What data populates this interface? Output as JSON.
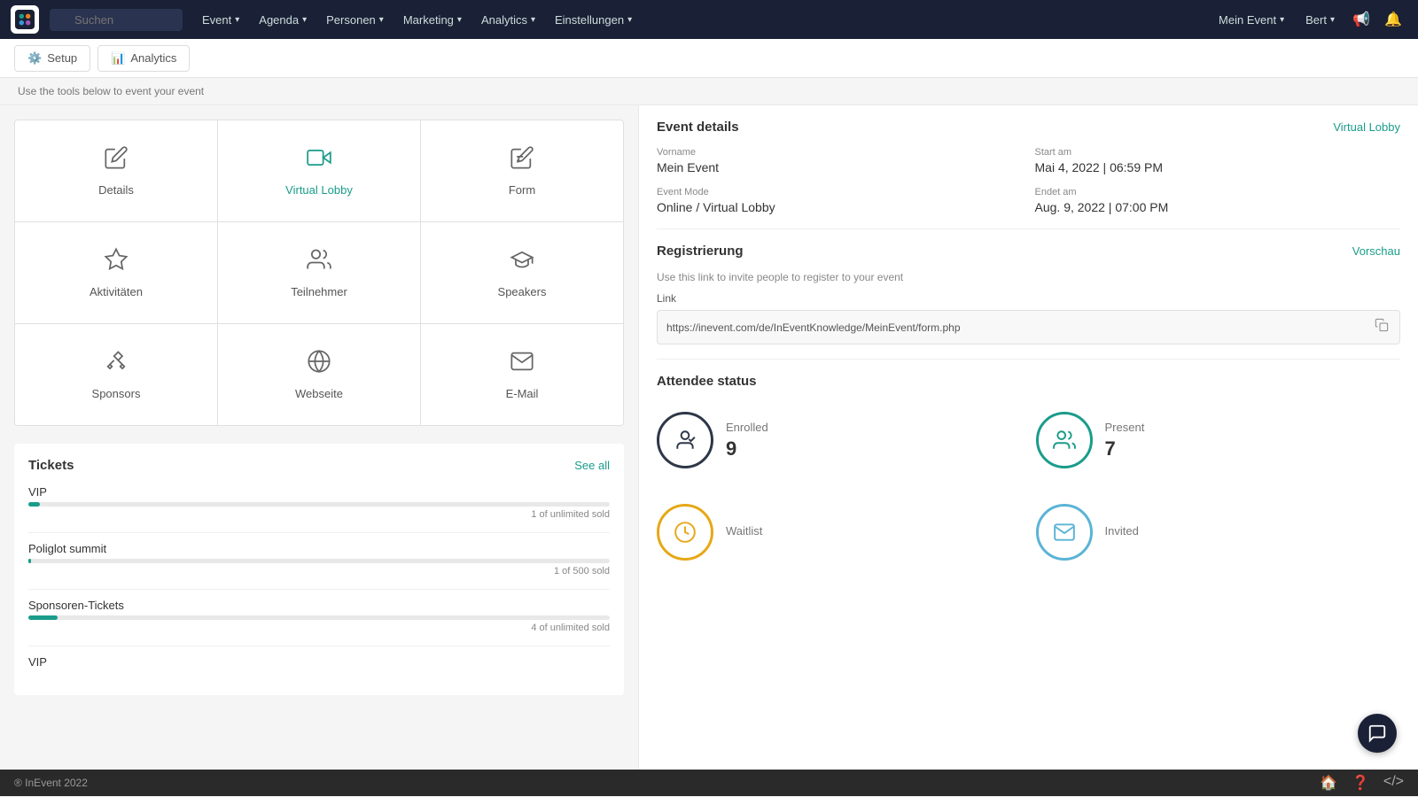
{
  "nav": {
    "search_placeholder": "Suchen",
    "menu_items": [
      {
        "label": "Event",
        "id": "event"
      },
      {
        "label": "Agenda",
        "id": "agenda"
      },
      {
        "label": "Personen",
        "id": "personen"
      },
      {
        "label": "Marketing",
        "id": "marketing"
      },
      {
        "label": "Analytics",
        "id": "analytics"
      },
      {
        "label": "Einstellungen",
        "id": "einstellungen"
      }
    ],
    "right_items": [
      {
        "label": "Mein Event",
        "id": "mein-event"
      },
      {
        "label": "Bert",
        "id": "bert"
      }
    ]
  },
  "sub_nav": {
    "setup_label": "Setup",
    "analytics_label": "Analytics"
  },
  "helper_text": "Use the tools below to event your event",
  "tools": [
    {
      "id": "details",
      "label": "Details",
      "icon": "✏️",
      "highlight": false
    },
    {
      "id": "virtual-lobby",
      "label": "Virtual Lobby",
      "icon": "🎥",
      "highlight": true
    },
    {
      "id": "form",
      "label": "Form",
      "icon": "📝",
      "highlight": false
    },
    {
      "id": "aktivitaten",
      "label": "Aktivitäten",
      "icon": "⭐",
      "highlight": false
    },
    {
      "id": "teilnehmer",
      "label": "Teilnehmer",
      "icon": "👥",
      "highlight": false
    },
    {
      "id": "speakers",
      "label": "Speakers",
      "icon": "🎓",
      "highlight": false
    },
    {
      "id": "sponsors",
      "label": "Sponsors",
      "icon": "🤝",
      "highlight": false
    },
    {
      "id": "webseite",
      "label": "Webseite",
      "icon": "🌐",
      "highlight": false
    },
    {
      "id": "email",
      "label": "E-Mail",
      "icon": "✉️",
      "highlight": false
    }
  ],
  "tickets": {
    "title": "Tickets",
    "see_all": "See all",
    "items": [
      {
        "name": "VIP",
        "sold": "1 of unlimited sold",
        "percent": 0.2
      },
      {
        "name": "Poliglot summit",
        "sold": "1 of 500 sold",
        "percent": 0.3
      },
      {
        "name": "Sponsoren-Tickets",
        "sold": "4 of unlimited sold",
        "percent": 2
      },
      {
        "name": "VIP",
        "sold": "",
        "percent": 0
      }
    ]
  },
  "event_details": {
    "section_title": "Event details",
    "virtual_lobby_link": "Virtual Lobby",
    "fields": [
      {
        "label": "Vorname",
        "value": "Mein Event"
      },
      {
        "label": "Start am",
        "value": "Mai 4, 2022 | 06:59 PM"
      },
      {
        "label": "Event Mode",
        "value": "Online / Virtual Lobby"
      },
      {
        "label": "Endet am",
        "value": "Aug. 9, 2022 | 07:00 PM"
      }
    ]
  },
  "registration": {
    "section_title": "Registrierung",
    "preview_link": "Vorschau",
    "description": "Use this link to invite people to register to your event",
    "link_label": "Link",
    "link_url": "https://inevent.com/de/InEventKnowledge/MeinEvent/form.php"
  },
  "attendee_status": {
    "section_title": "Attendee status",
    "statuses": [
      {
        "id": "enrolled",
        "label": "Enrolled",
        "count": "9",
        "color_class": "enrolled"
      },
      {
        "id": "present",
        "label": "Present",
        "count": "7",
        "color_class": "present"
      },
      {
        "id": "waitlist",
        "label": "Waitlist",
        "count": "",
        "color_class": "waitlist"
      },
      {
        "id": "invited",
        "label": "Invited",
        "count": "",
        "color_class": "invited"
      }
    ]
  },
  "footer": {
    "copyright": "® InEvent 2022"
  }
}
